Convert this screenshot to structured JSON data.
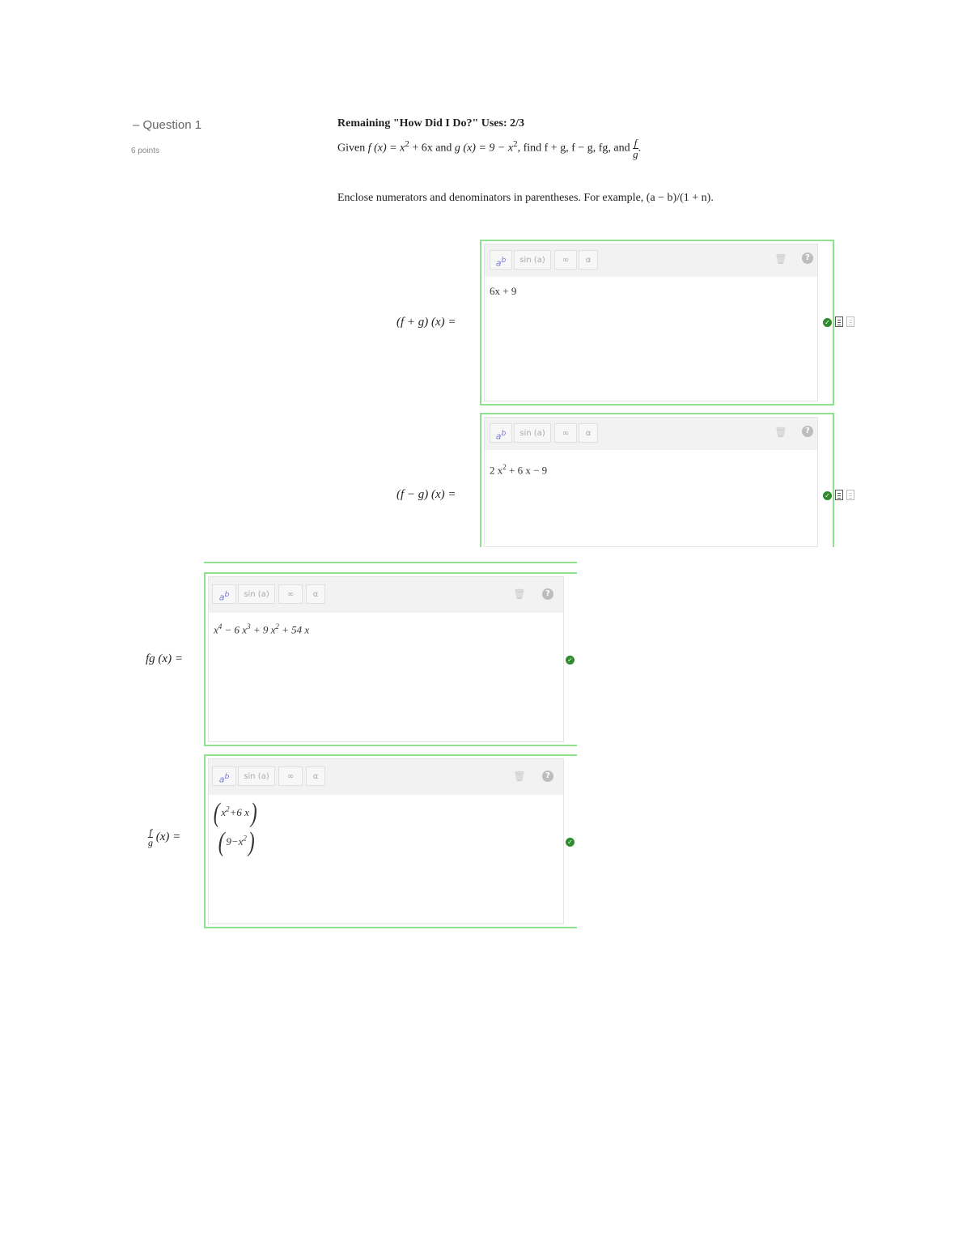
{
  "question": {
    "title": "Question 1",
    "points": "6 points",
    "remaining": "Remaining \"How Did I Do?\" Uses: 2/3",
    "given_prefix": "Given ",
    "given_f": "f (x) = x",
    "given_f_exp": "2",
    "given_f_rest": " + 6x and ",
    "given_g": "g (x) = 9 − x",
    "given_g_exp": "2",
    "given_find": ", find f + g, f − g, fg, and ",
    "frac_num": "f",
    "frac_den": "g",
    "given_end": ".",
    "instruction": "Enclose numerators and denominators in parentheses. For example, (a − b)/(1 + n)."
  },
  "toolbar": {
    "exp_label": "a",
    "exp_sup": "b",
    "sin_label": "sin (a)",
    "inf_label": "∞",
    "alpha_label": "α",
    "trash_icon": "trash-icon",
    "help_icon": "help-icon"
  },
  "answers": [
    {
      "label": "(f + g) (x) =",
      "value": "6x + 9"
    },
    {
      "label": "(f − g) (x) =",
      "value_base": "2 x",
      "value_exp": "2",
      "value_rest": " + 6 x − 9"
    },
    {
      "label": "fg (x) =",
      "t1": "x",
      "t1e": "4",
      "t2": " − 6 x",
      "t2e": "3",
      "t3": " + 9 x",
      "t3e": "2",
      "t4": " + 54 x"
    },
    {
      "label_num": "f",
      "label_den": "g",
      "label_rest": " (x) =",
      "num_base": "x",
      "num_exp": "2",
      "num_rest": "+6 x",
      "den_base": "9−x",
      "den_exp": "2"
    }
  ],
  "status": {
    "correct_color": "#2e8b2e",
    "border_color": "#8ee28e"
  }
}
